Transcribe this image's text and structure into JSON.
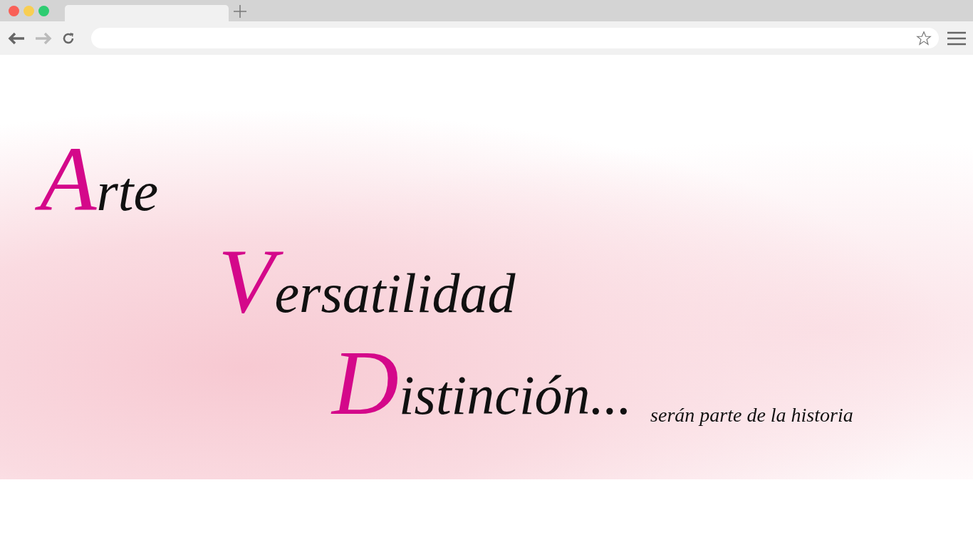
{
  "browser": {
    "tabs": [
      {
        "selected": true
      }
    ]
  },
  "hero": {
    "lines": [
      "Arte",
      "Versatilidad",
      "Distinción..."
    ],
    "tagline": "serán parte de la  historia"
  }
}
